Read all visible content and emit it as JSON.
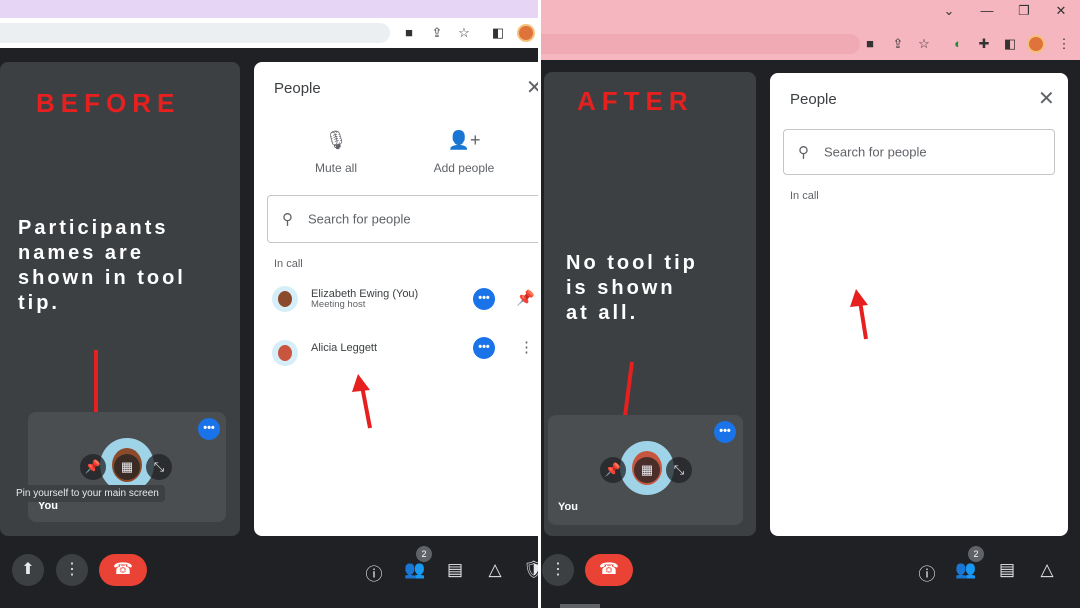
{
  "colors": {
    "before_accent": "#e5201f",
    "after_chrome": "#f6b6bf",
    "before_chrome": "#e6d5f5",
    "panel_bg": "#ffffff",
    "stage_bg": "#3c4043",
    "more_button": "#1a73e8",
    "end_call": "#ea4335"
  },
  "before": {
    "heading": "BEFORE",
    "note": "Participants\n  names are\n  shown in tool\ntip.",
    "tooltip": "Pin yourself to your main screen",
    "tile_name": "You",
    "panel": {
      "title": "People",
      "actions": [
        {
          "label": "Mute all",
          "icon": "mic-off-icon"
        },
        {
          "label": "Add people",
          "icon": "add-person-icon"
        }
      ],
      "search_placeholder": "Search for people",
      "section": "In call",
      "participants": [
        {
          "name": "Elizabeth Ewing (You)",
          "role": "Meeting host",
          "trailing_icon": "pin-icon"
        },
        {
          "name": "Alicia Leggett",
          "role": "",
          "trailing_icon": "more-vert-icon"
        }
      ]
    },
    "participant_count": "2"
  },
  "after": {
    "heading": "AFTER",
    "note": "No tool tip\nis shown\nat all.",
    "tile_name": "You",
    "panel": {
      "title": "People",
      "search_placeholder": "Search for people",
      "section": "In call"
    },
    "participant_count": "2"
  },
  "icons": {
    "more": "•••",
    "close": "✕",
    "search": "⚲",
    "pin": "⚲",
    "end_call": "☎",
    "info": "ⓘ",
    "people": "👥",
    "chat": "▤",
    "activities": "△",
    "more_vert": "⋮",
    "present": "⬆"
  }
}
